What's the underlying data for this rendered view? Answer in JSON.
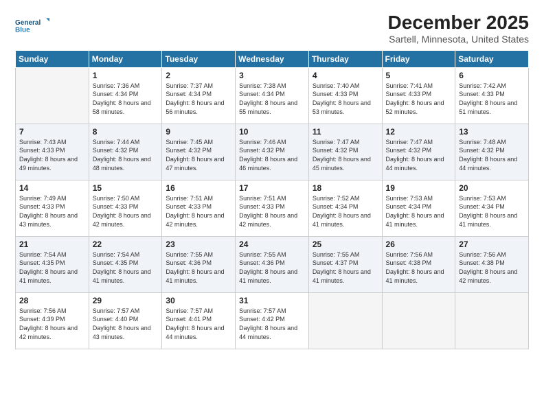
{
  "logo": {
    "line1": "General",
    "line2": "Blue"
  },
  "title": "December 2025",
  "subtitle": "Sartell, Minnesota, United States",
  "days_of_week": [
    "Sunday",
    "Monday",
    "Tuesday",
    "Wednesday",
    "Thursday",
    "Friday",
    "Saturday"
  ],
  "weeks": [
    [
      {
        "day": "",
        "empty": true
      },
      {
        "day": "1",
        "sunrise": "7:36 AM",
        "sunset": "4:34 PM",
        "daylight": "8 hours and 58 minutes."
      },
      {
        "day": "2",
        "sunrise": "7:37 AM",
        "sunset": "4:34 PM",
        "daylight": "8 hours and 56 minutes."
      },
      {
        "day": "3",
        "sunrise": "7:38 AM",
        "sunset": "4:34 PM",
        "daylight": "8 hours and 55 minutes."
      },
      {
        "day": "4",
        "sunrise": "7:40 AM",
        "sunset": "4:33 PM",
        "daylight": "8 hours and 53 minutes."
      },
      {
        "day": "5",
        "sunrise": "7:41 AM",
        "sunset": "4:33 PM",
        "daylight": "8 hours and 52 minutes."
      },
      {
        "day": "6",
        "sunrise": "7:42 AM",
        "sunset": "4:33 PM",
        "daylight": "8 hours and 51 minutes."
      }
    ],
    [
      {
        "day": "7",
        "sunrise": "7:43 AM",
        "sunset": "4:33 PM",
        "daylight": "8 hours and 49 minutes."
      },
      {
        "day": "8",
        "sunrise": "7:44 AM",
        "sunset": "4:32 PM",
        "daylight": "8 hours and 48 minutes."
      },
      {
        "day": "9",
        "sunrise": "7:45 AM",
        "sunset": "4:32 PM",
        "daylight": "8 hours and 47 minutes."
      },
      {
        "day": "10",
        "sunrise": "7:46 AM",
        "sunset": "4:32 PM",
        "daylight": "8 hours and 46 minutes."
      },
      {
        "day": "11",
        "sunrise": "7:47 AM",
        "sunset": "4:32 PM",
        "daylight": "8 hours and 45 minutes."
      },
      {
        "day": "12",
        "sunrise": "7:47 AM",
        "sunset": "4:32 PM",
        "daylight": "8 hours and 44 minutes."
      },
      {
        "day": "13",
        "sunrise": "7:48 AM",
        "sunset": "4:32 PM",
        "daylight": "8 hours and 44 minutes."
      }
    ],
    [
      {
        "day": "14",
        "sunrise": "7:49 AM",
        "sunset": "4:33 PM",
        "daylight": "8 hours and 43 minutes."
      },
      {
        "day": "15",
        "sunrise": "7:50 AM",
        "sunset": "4:33 PM",
        "daylight": "8 hours and 42 minutes."
      },
      {
        "day": "16",
        "sunrise": "7:51 AM",
        "sunset": "4:33 PM",
        "daylight": "8 hours and 42 minutes."
      },
      {
        "day": "17",
        "sunrise": "7:51 AM",
        "sunset": "4:33 PM",
        "daylight": "8 hours and 42 minutes."
      },
      {
        "day": "18",
        "sunrise": "7:52 AM",
        "sunset": "4:34 PM",
        "daylight": "8 hours and 41 minutes."
      },
      {
        "day": "19",
        "sunrise": "7:53 AM",
        "sunset": "4:34 PM",
        "daylight": "8 hours and 41 minutes."
      },
      {
        "day": "20",
        "sunrise": "7:53 AM",
        "sunset": "4:34 PM",
        "daylight": "8 hours and 41 minutes."
      }
    ],
    [
      {
        "day": "21",
        "sunrise": "7:54 AM",
        "sunset": "4:35 PM",
        "daylight": "8 hours and 41 minutes."
      },
      {
        "day": "22",
        "sunrise": "7:54 AM",
        "sunset": "4:35 PM",
        "daylight": "8 hours and 41 minutes."
      },
      {
        "day": "23",
        "sunrise": "7:55 AM",
        "sunset": "4:36 PM",
        "daylight": "8 hours and 41 minutes."
      },
      {
        "day": "24",
        "sunrise": "7:55 AM",
        "sunset": "4:36 PM",
        "daylight": "8 hours and 41 minutes."
      },
      {
        "day": "25",
        "sunrise": "7:55 AM",
        "sunset": "4:37 PM",
        "daylight": "8 hours and 41 minutes."
      },
      {
        "day": "26",
        "sunrise": "7:56 AM",
        "sunset": "4:38 PM",
        "daylight": "8 hours and 41 minutes."
      },
      {
        "day": "27",
        "sunrise": "7:56 AM",
        "sunset": "4:38 PM",
        "daylight": "8 hours and 42 minutes."
      }
    ],
    [
      {
        "day": "28",
        "sunrise": "7:56 AM",
        "sunset": "4:39 PM",
        "daylight": "8 hours and 42 minutes."
      },
      {
        "day": "29",
        "sunrise": "7:57 AM",
        "sunset": "4:40 PM",
        "daylight": "8 hours and 43 minutes."
      },
      {
        "day": "30",
        "sunrise": "7:57 AM",
        "sunset": "4:41 PM",
        "daylight": "8 hours and 44 minutes."
      },
      {
        "day": "31",
        "sunrise": "7:57 AM",
        "sunset": "4:42 PM",
        "daylight": "8 hours and 44 minutes."
      },
      {
        "day": "",
        "empty": true
      },
      {
        "day": "",
        "empty": true
      },
      {
        "day": "",
        "empty": true
      }
    ]
  ]
}
